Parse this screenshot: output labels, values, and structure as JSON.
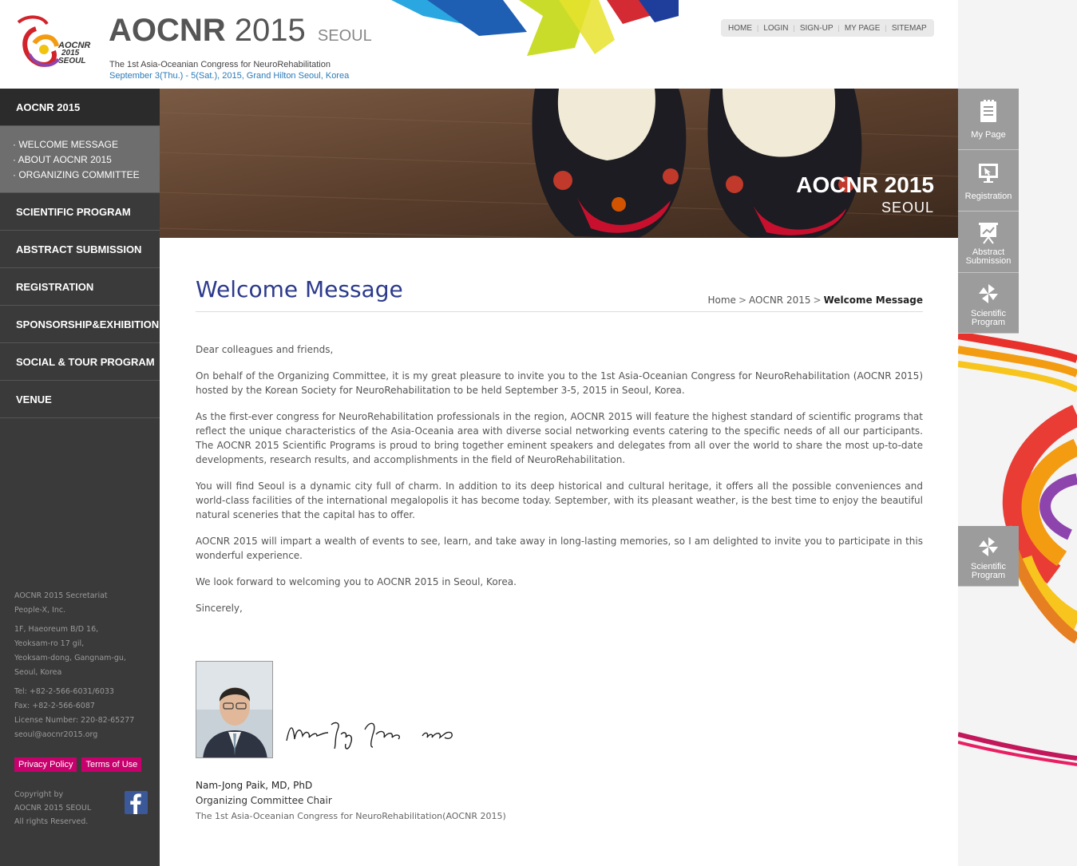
{
  "header": {
    "title_main": "AOCNR",
    "title_year": "2015",
    "title_city": "SEOUL",
    "subtitle": "The 1st Asia-Oceanian Congress for NeuroRehabilitation",
    "date_venue": "September 3(Thu.) - 5(Sat.), 2015, Grand Hilton Seoul, Korea",
    "logo_text": [
      "AOCNR",
      "2015",
      "SEOUL"
    ]
  },
  "util_nav": [
    "HOME",
    "LOGIN",
    "SIGN-UP",
    "MY PAGE",
    "SITEMAP"
  ],
  "sidebar": {
    "active_section": "AOCNR 2015",
    "submenu": [
      "· WELCOME MESSAGE",
      "· ABOUT AOCNR 2015",
      "· ORGANIZING COMMITTEE"
    ],
    "sections": [
      "SCIENTIFIC PROGRAM",
      "ABSTRACT SUBMISSION",
      "REGISTRATION",
      "SPONSORSHIP&EXHIBITION",
      "SOCIAL & TOUR PROGRAM",
      "VENUE"
    ]
  },
  "footer": {
    "secretariat": [
      "AOCNR 2015 Secretariat",
      "People-X, Inc."
    ],
    "address": [
      "1F, Haeoreum B/D 16,",
      "Yeoksam-ro 17 gil,",
      "Yeoksam-dong, Gangnam-gu,",
      "Seoul, Korea"
    ],
    "contact": [
      "Tel: +82-2-566-6031/6033",
      "Fax: +82-2-566-6087",
      "License Number: 220-82-65277",
      "seoul@aocnr2015.org"
    ],
    "privacy_label": "Privacy Policy",
    "terms_label": "Terms of Use",
    "copyright": [
      "Copyright by",
      "AOCNR 2015 SEOUL",
      "All rights Reserved."
    ]
  },
  "banner": {
    "title": "AOCNR 2015",
    "city": "SEOUL"
  },
  "page": {
    "title": "Welcome Message",
    "breadcrumb": [
      "Home",
      "AOCNR 2015",
      "Welcome Message"
    ],
    "paragraphs": [
      "Dear colleagues and friends,",
      "On behalf of the Organizing Committee, it is my great pleasure to invite you to the 1st Asia-Oceanian Congress for NeuroRehabilitation (AOCNR 2015) hosted by the Korean Society for NeuroRehabilitation to be held September 3-5, 2015 in Seoul, Korea.",
      "As the first-ever congress for NeuroRehabilitation professionals in the region, AOCNR 2015 will feature the highest standard of scientific programs that reflect the unique characteristics of the Asia-Oceania area with diverse social networking events catering to the specific needs of all our participants. The AOCNR 2015 Scientific Programs is proud to bring together eminent speakers and delegates from all over the world to share the most up-to-date developments, research results, and accomplishments in the field of NeuroRehabilitation.",
      "You will find Seoul is a dynamic city full of charm. In addition to its deep historical and cultural heritage, it offers all the possible conveniences and world-class facilities of the international megalopolis it has become today. September, with its pleasant weather, is the best time to enjoy the beautiful natural sceneries that the capital has to offer.",
      "AOCNR 2015 will impart a wealth of events to see, learn, and take away in long-lasting memories, so I am delighted to invite you to participate in this wonderful experience.",
      "We look forward to welcoming you to AOCNR 2015 in Seoul, Korea.",
      "Sincerely,"
    ],
    "signer_name": "Nam-Jong Paik, MD, PhD",
    "signer_role": "Organizing Committee Chair",
    "signer_org": "The 1st Asia-Oceanian Congress for NeuroRehabilitation(AOCNR 2015)"
  },
  "quick_menu": [
    {
      "label": [
        "My Page"
      ],
      "icon": "document-icon"
    },
    {
      "label": [
        "Registration"
      ],
      "icon": "monitor-icon"
    },
    {
      "label": [
        "Abstract",
        "Submission"
      ],
      "icon": "presentation-icon"
    },
    {
      "label": [
        "Scientific",
        "Program"
      ],
      "icon": "pinwheel-icon"
    }
  ],
  "floating_quick": {
    "label": [
      "Scientific",
      "Program"
    ],
    "icon": "pinwheel-icon"
  },
  "colors": {
    "sidebar_bg": "#3a3a3a",
    "submenu_bg": "#6e6e6e",
    "title_blue": "#2c3a8c",
    "date_blue": "#2a7ab8",
    "accent_pink": "#c8006d",
    "quick_gray": "#9c9c9c"
  }
}
